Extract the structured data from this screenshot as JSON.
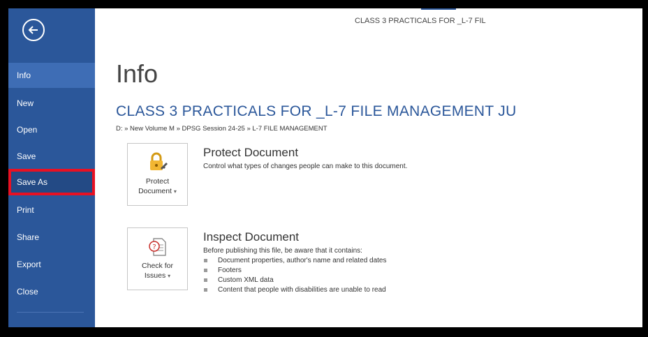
{
  "titlebar": {
    "document_title": "CLASS 3 PRACTICALS FOR _L-7 FIL"
  },
  "sidebar": {
    "items": [
      {
        "label": "Info"
      },
      {
        "label": "New"
      },
      {
        "label": "Open"
      },
      {
        "label": "Save"
      },
      {
        "label": "Save As"
      },
      {
        "label": "Print"
      },
      {
        "label": "Share"
      },
      {
        "label": "Export"
      },
      {
        "label": "Close"
      }
    ]
  },
  "main": {
    "page_title": "Info",
    "doc_heading": "CLASS 3 PRACTICALS FOR _L-7 FILE MANAGEMENT JU",
    "doc_path": "D: » New Volume M » DPSG Session 24-25 » L-7 FILE MANAGEMENT",
    "protect": {
      "tile_line1": "Protect",
      "tile_line2": "Document",
      "title": "Protect Document",
      "description": "Control what types of changes people can make to this document."
    },
    "inspect": {
      "tile_line1": "Check for",
      "tile_line2": "Issues",
      "title": "Inspect Document",
      "description": "Before publishing this file, be aware that it contains:",
      "bullets": [
        "Document properties, author's name and related dates",
        "Footers",
        "Custom XML data",
        "Content that people with disabilities are unable to read"
      ]
    }
  },
  "colors": {
    "sidebar": "#2b579a",
    "active_item": "#3e6db5",
    "highlight_box": "#e81123",
    "heading": "#2b579a"
  },
  "icons": {
    "back": "back-arrow-icon",
    "protect": "lock-key-icon",
    "inspect": "inspect-document-icon",
    "bullet": "square-bullet-icon"
  }
}
